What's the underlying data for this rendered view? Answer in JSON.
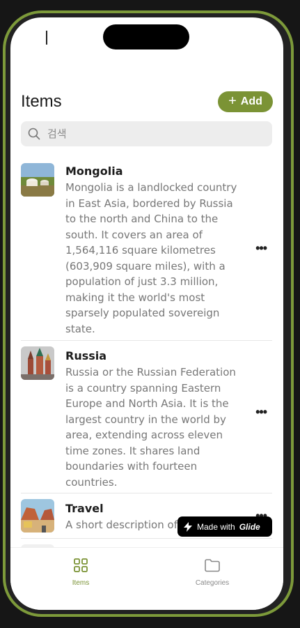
{
  "colors": {
    "accent": "#7b9335",
    "frame": "#7d9a3a"
  },
  "header": {
    "title": "Items",
    "add_label": "Add"
  },
  "search": {
    "placeholder": "검색"
  },
  "items": [
    {
      "title": "Mongolia",
      "description": "Mongolia is a landlocked country in East Asia, bordered by Russia to the north and China to the south. It covers an area of 1,564,116 square kilometres (603,909 square miles), with a population of just 3.3 million, making it the world's most sparsely populated sovereign state.",
      "image": "yurt-landscape"
    },
    {
      "title": "Russia",
      "description": "Russia or the Russian Federation is a country spanning Eastern Europe and North Asia. It is the largest country in the world by area, extending across eleven time zones. It shares land boundaries with fourteen countries.",
      "image": "kremlin-cathedral"
    },
    {
      "title": "Travel",
      "description": "A short description of",
      "image": "desert-road-car"
    }
  ],
  "badge": {
    "prefix": "Made with",
    "brand": "Glide"
  },
  "tabs": [
    {
      "label": "Items",
      "icon": "grid-icon",
      "active": true
    },
    {
      "label": "Categories",
      "icon": "folder-icon",
      "active": false
    }
  ]
}
